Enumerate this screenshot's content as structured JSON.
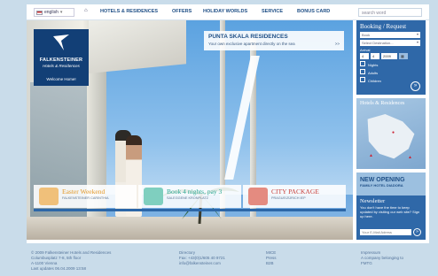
{
  "nav": {
    "language": "english",
    "home_icon": "home-icon",
    "items": [
      "HOTELS & RESIDENCES",
      "OFFERS",
      "HOLIDAY WORLDS",
      "SERVICE",
      "BONUS CARD"
    ],
    "search_placeholder": "search word"
  },
  "logo": {
    "brand": "FALKENSTEINER",
    "sub": "Hotels & Residences",
    "welcome": "Welcome Home!"
  },
  "promo": {
    "title": "PUNTA SKALA RESIDENCES",
    "desc": "Your own exclusive apartment directly on the sea",
    "more": ">>"
  },
  "offers": [
    {
      "title": "Easter Weekend",
      "sub": "FALKENSTEINER CARINTHIA",
      "color": "orange"
    },
    {
      "title": "Book 4 nights, pay 3",
      "sub": "SALEGGENE KRONPLATZ",
      "color": "green"
    },
    {
      "title": "CITY PACKAGE",
      "sub": "PRAGUE/ZÜRICH IEP",
      "color": "red"
    }
  ],
  "booking": {
    "title": "Booking / Request",
    "select1": "Book",
    "select2": "Select Destination...",
    "arrival_label": "Arrival",
    "day": "4",
    "month": "4",
    "year": "2009",
    "nights": "Nights",
    "adults": "Adults",
    "children": "Children"
  },
  "map": {
    "title": "Hotels & Residences"
  },
  "news": {
    "title": "NEW OPENING",
    "sub": "FAMILY HOTEL DIADORA"
  },
  "newsletter": {
    "title": "Newsletter",
    "text": "You don't have the time to keep updated by visiting our web site? Sign up here.",
    "email_placeholder": "Your E-Mail Adress"
  },
  "footer": {
    "col1": [
      "© 2009 Falkensteiner Hotels and Residences",
      "Columbusplatz 7-8, 5th floor",
      "A-1100 Vienna",
      "Last updates 06.04.2009 13:58"
    ],
    "col2": [
      "Directory",
      "Fax: +43(0)1/605 40 9721",
      "info@falkensteiner.com"
    ],
    "col3": [
      "MICE",
      "Press",
      "B2B"
    ],
    "col4": [
      "Impressum",
      "A company belonging to",
      "FMTG"
    ]
  },
  "colors": {
    "primary": "#2f68a8",
    "dark": "#123f76",
    "accent_orange": "#e49a2b",
    "accent_green": "#2aa792",
    "accent_red": "#c8423c"
  }
}
